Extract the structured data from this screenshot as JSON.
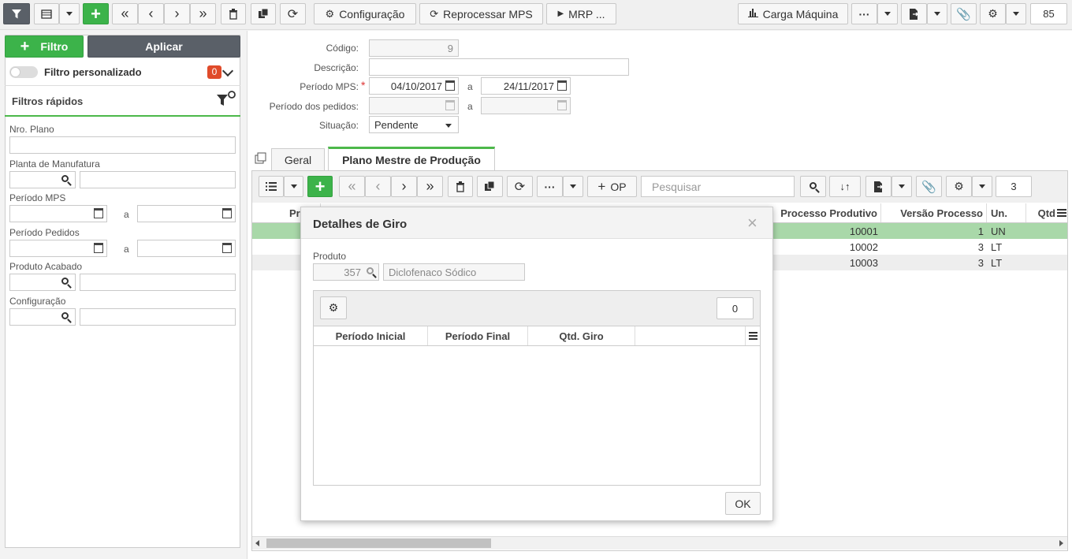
{
  "toolbar": {
    "config_label": "Configuração",
    "reprocess_label": "Reprocessar MPS",
    "mrp_label": "MRP ...",
    "carga_label": "Carga Máquina",
    "count": "85"
  },
  "sidebar": {
    "filter_label": "Filtro",
    "apply_label": "Aplicar",
    "custom_filter_label": "Filtro personalizado",
    "custom_filter_count": "0",
    "quick_filters_title": "Filtros rápidos",
    "fields": {
      "nro_plano": "Nro. Plano",
      "planta": "Planta de Manufatura",
      "periodo_mps": "Período MPS",
      "periodo_pedidos": "Período Pedidos",
      "produto_acabado": "Produto Acabado",
      "configuracao": "Configuração",
      "a1": "a",
      "a2": "a"
    }
  },
  "form": {
    "codigo_label": "Código:",
    "codigo_value": "9",
    "descricao_label": "Descrição:",
    "descricao_value": "",
    "periodo_mps_label": "Período MPS:",
    "periodo_mps_from": "04/10/2017",
    "periodo_mps_to": "24/11/2017",
    "periodo_pedidos_label": "Período dos pedidos:",
    "a_label": "a",
    "a_label2": "a",
    "situacao_label": "Situação:",
    "situacao_value": "Pendente"
  },
  "tabs": {
    "geral": "Geral",
    "plano": "Plano Mestre de Produção"
  },
  "grid": {
    "op_label": "OP",
    "search_placeholder": "Pesquisar",
    "count": "3",
    "col_pr": "Pr",
    "col_processo": "Processo Produtivo",
    "col_versao": "Versão Processo",
    "col_un": "Un.",
    "col_qtd": "Qtd",
    "rows": [
      {
        "processo": "10001",
        "versao": "1",
        "un": "UN"
      },
      {
        "processo": "10002",
        "versao": "3",
        "un": "LT"
      },
      {
        "processo": "10003",
        "versao": "3",
        "un": "LT"
      }
    ]
  },
  "modal": {
    "title": "Detalhes de Giro",
    "produto_label": "Produto",
    "produto_code": "357",
    "produto_name": "Diclofenaco Sódico",
    "count": "0",
    "col_inicial": "Período Inicial",
    "col_final": "Período Final",
    "col_qtd": "Qtd. Giro",
    "ok_label": "OK"
  },
  "colors": {
    "green": "#3cb34a",
    "selected_row": "#a9d8a9"
  }
}
